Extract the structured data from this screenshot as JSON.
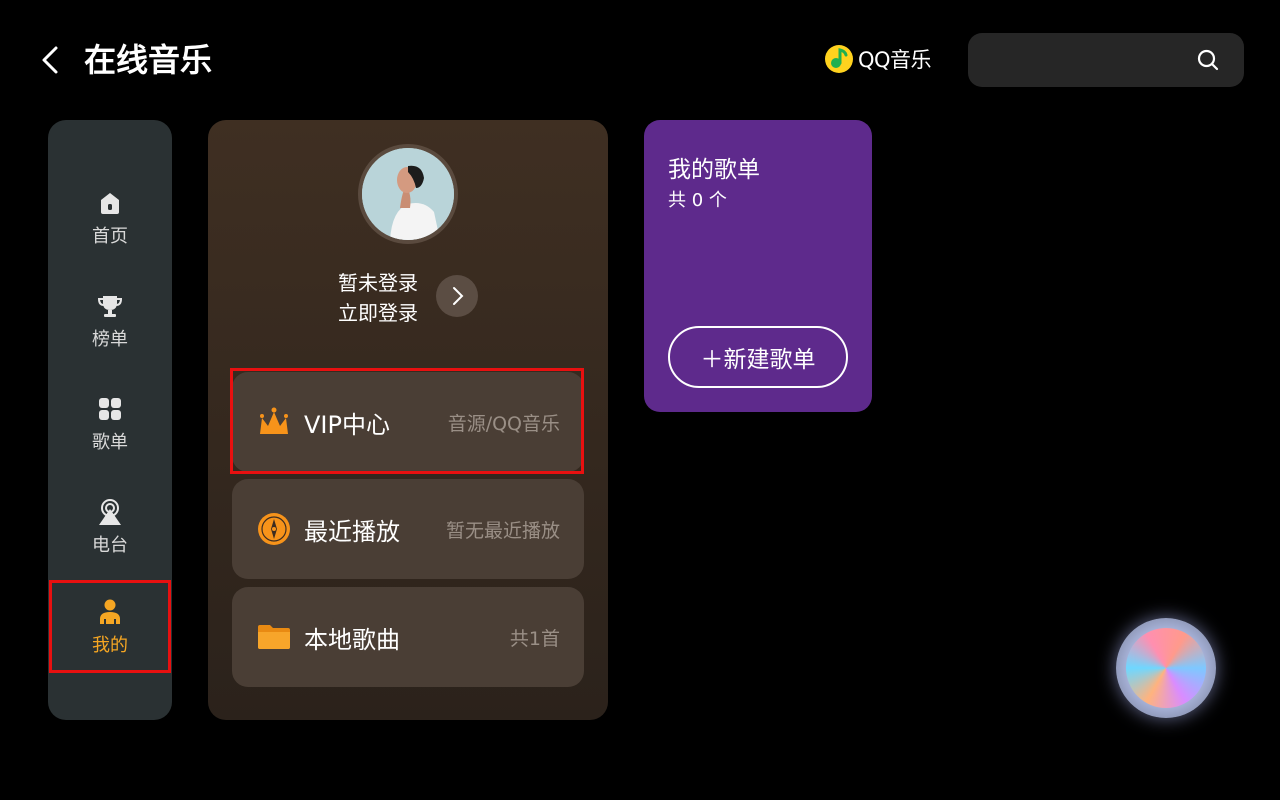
{
  "header": {
    "title": "在线音乐",
    "brand": "QQ音乐"
  },
  "sidebar": {
    "items": [
      {
        "label": "首页",
        "icon": "home-icon"
      },
      {
        "label": "榜单",
        "icon": "trophy-icon"
      },
      {
        "label": "歌单",
        "icon": "grid-icon"
      },
      {
        "label": "电台",
        "icon": "radio-tower-icon"
      },
      {
        "label": "我的",
        "icon": "person-icon",
        "active": true
      }
    ]
  },
  "profile": {
    "status": "暂未登录",
    "login": "立即登录",
    "menu": [
      {
        "label": "VIP中心",
        "sub": "音源/QQ音乐",
        "icon": "crown-icon"
      },
      {
        "label": "最近播放",
        "sub": "暂无最近播放",
        "icon": "compass-icon"
      },
      {
        "label": "本地歌曲",
        "sub": "共1首",
        "icon": "folder-icon"
      }
    ]
  },
  "playlist": {
    "title": "我的歌单",
    "count": "共 0 个",
    "create": "＋新建歌单"
  },
  "colors": {
    "accent": "#f5a623",
    "highlight": "#e81010",
    "playlist_bg": "#5e2a8c"
  }
}
